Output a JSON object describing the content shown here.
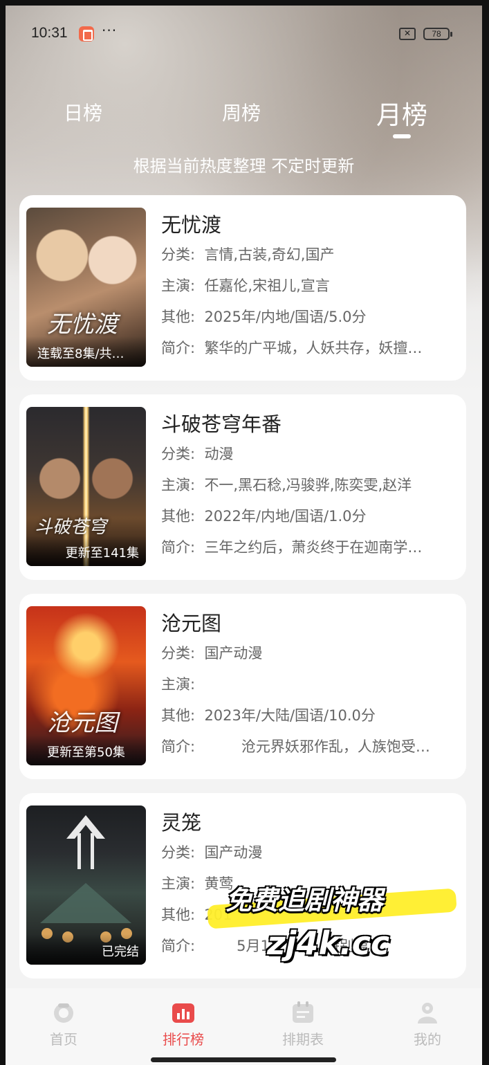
{
  "status_bar": {
    "time": "10:31",
    "more": "···",
    "battery": "78"
  },
  "tabs": [
    {
      "label": "日榜",
      "active": false
    },
    {
      "label": "周榜",
      "active": false
    },
    {
      "label": "月榜",
      "active": true
    }
  ],
  "subtitle": "根据当前热度整理 不定时更新",
  "field_labels": {
    "category": "分类:",
    "cast": "主演:",
    "other": "其他:",
    "summary": "简介:"
  },
  "items": [
    {
      "title": "无忧渡",
      "poster_caption": "连载至8集/共…",
      "poster_art_text": "无忧渡",
      "category": "言情,古装,奇幻,国产",
      "cast": "任嘉伦,宋祖儿,宣言",
      "other": "2025年/内地/国语/5.0分",
      "summary": "繁华的广平城，人妖共存，妖擅…"
    },
    {
      "title": "斗破苍穹年番",
      "poster_caption": "更新至141集",
      "poster_art_text": "斗破苍穹",
      "category": "动漫",
      "cast": "不一,黑石稔,冯骏骅,陈奕雯,赵洋",
      "other": "2022年/内地/国语/1.0分",
      "summary": "三年之约后，萧炎终于在迦南学…"
    },
    {
      "title": "沧元图",
      "poster_caption": "更新至第50集",
      "poster_art_text": "沧元图",
      "category": "国产动漫",
      "cast": "",
      "other": "2023年/大陆/国语/10.0分",
      "summary": "        沧元界妖邪作乱，人族饱受…"
    },
    {
      "title": "灵笼",
      "poster_caption": "已完结",
      "poster_art_text": "",
      "category": "国产动漫",
      "cast": "黄莺",
      "other": "201",
      "summary": "       5月1            特别篇…"
    }
  ],
  "watermark": {
    "line1": "免费追剧神器",
    "line2": "zj4k.cc"
  },
  "nav": [
    {
      "label": "首页",
      "icon": "home-icon",
      "active": false
    },
    {
      "label": "排行榜",
      "icon": "ranking-icon",
      "active": true
    },
    {
      "label": "排期表",
      "icon": "schedule-icon",
      "active": false
    },
    {
      "label": "我的",
      "icon": "profile-icon",
      "active": false
    }
  ],
  "colors": {
    "accent": "#e94b4b",
    "watermark_highlight": "#ffee2a"
  }
}
